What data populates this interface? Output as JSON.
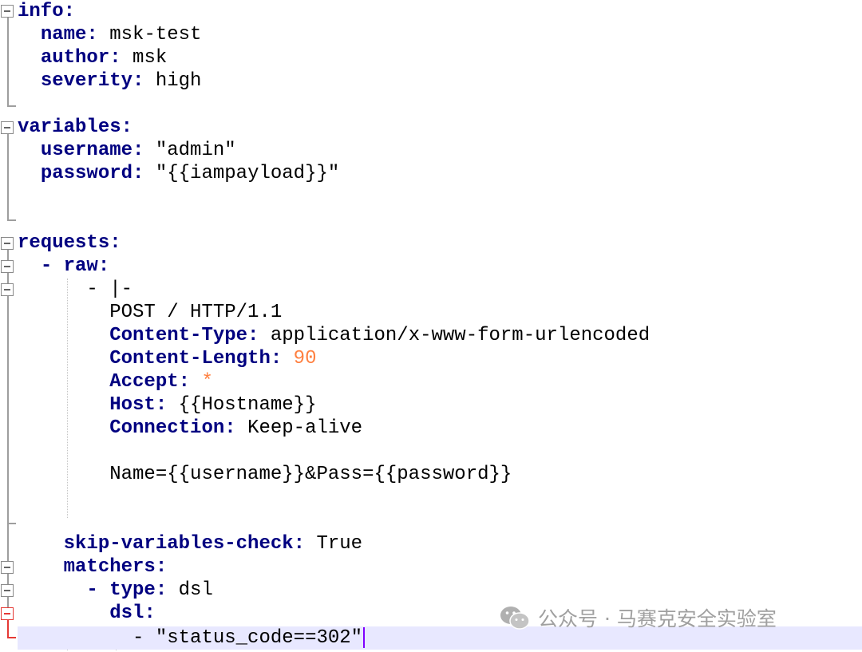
{
  "editor": {
    "lines": [
      {
        "key": "info",
        "sep": ":",
        "value": ""
      },
      {
        "key": "name",
        "sep": ": ",
        "value": "msk-test"
      },
      {
        "key": "author",
        "sep": ": ",
        "value": "msk"
      },
      {
        "key": "severity",
        "sep": ": ",
        "value": "high"
      },
      {
        "key": "variables",
        "sep": ":",
        "value": ""
      },
      {
        "key": "username",
        "sep": ": ",
        "value": "\"admin\""
      },
      {
        "key": "password",
        "sep": ": ",
        "value": "\"{{iampayload}}\""
      },
      {
        "key": "requests",
        "sep": ":",
        "value": ""
      },
      {
        "key": "- raw",
        "sep": ":",
        "value": ""
      },
      {
        "text": "- |-"
      },
      {
        "text": "POST / HTTP/1.1"
      },
      {
        "key": "Content-Type",
        "sep": ": ",
        "value": "application/x-www-form-urlencoded"
      },
      {
        "key": "Content-Length",
        "sep": ": ",
        "value": "90"
      },
      {
        "key": "Accept",
        "sep": ": ",
        "value": "*"
      },
      {
        "key": "Host",
        "sep": ": ",
        "value": "{{Hostname}}"
      },
      {
        "key": "Connection",
        "sep": ": ",
        "value": "Keep-alive"
      },
      {
        "text": "Name={{username}}&Pass={{password}}"
      },
      {
        "key": "skip-variables-check",
        "sep": ": ",
        "value": "True"
      },
      {
        "key": "matchers",
        "sep": ":",
        "value": ""
      },
      {
        "key": "- type",
        "sep": ": ",
        "value": "dsl"
      },
      {
        "key": "dsl",
        "sep": ":",
        "value": ""
      },
      {
        "text": "- \"status_code==302\""
      }
    ]
  },
  "watermark": {
    "text": "公众号 · 马赛克安全实验室",
    "icon": "wechat-icon"
  },
  "colors": {
    "key": "#000080",
    "number": "#ff8040",
    "caret": "#8000ff",
    "current_line": "#e8e8ff",
    "fold_marker_active": "#e53935"
  }
}
